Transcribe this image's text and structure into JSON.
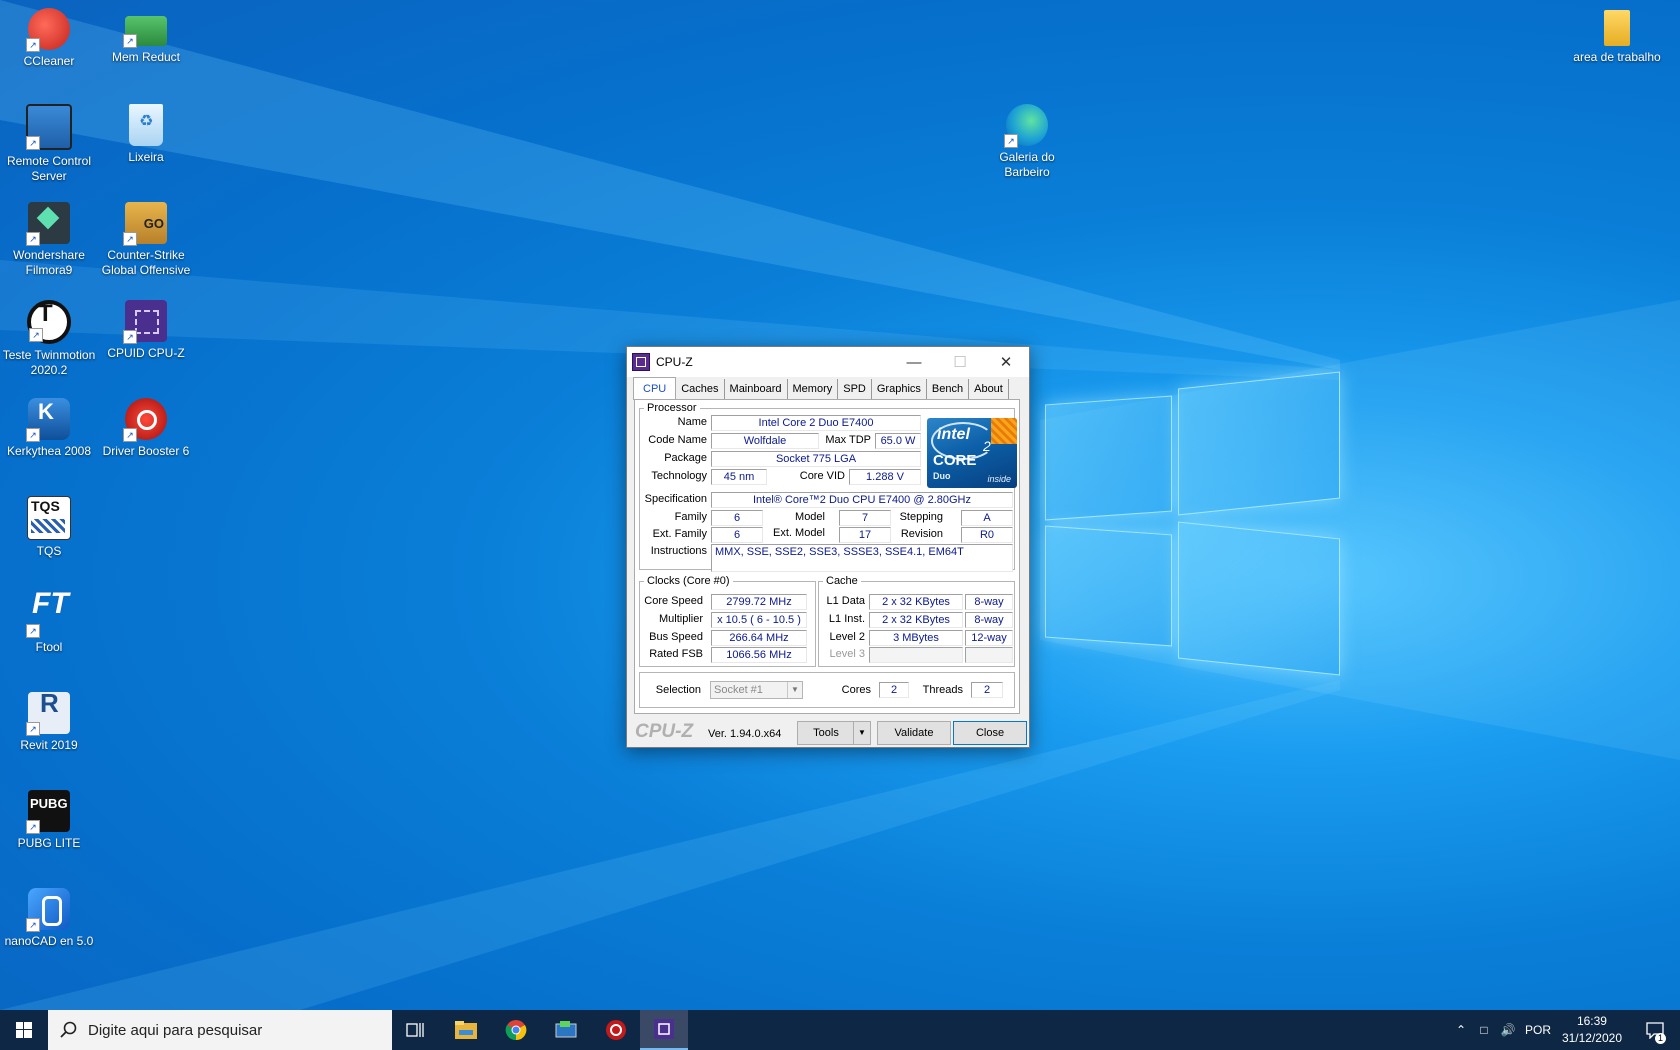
{
  "desktop": {
    "icons": [
      {
        "label_lines": [
          "CCleaner"
        ],
        "icon": "ccleaner-icon",
        "color": "#d9342b"
      },
      {
        "label_lines": [
          "Mem Reduct"
        ],
        "icon": "mem-reduct-icon",
        "color": "#3aa655"
      },
      {
        "label_lines": [
          "Remote Control",
          "Server"
        ],
        "icon": "remote-control-icon",
        "color": "#2a76c4"
      },
      {
        "label_lines": [
          "Lixeira"
        ],
        "icon": "recycle-bin-icon",
        "color": "#d6eefc"
      },
      {
        "label_lines": [
          "Wondershare",
          "Filmora9"
        ],
        "icon": "filmora-icon",
        "color": "#2b3a43"
      },
      {
        "label_lines": [
          "Counter-Strike",
          "Global Offensive"
        ],
        "icon": "csgo-icon",
        "color": "#d9a23c"
      },
      {
        "label_lines": [
          "Teste Twinmotion",
          "2020.2"
        ],
        "icon": "twinmotion-icon",
        "color": "#111111"
      },
      {
        "label_lines": [
          "CPUID CPU-Z"
        ],
        "icon": "cpuz-icon",
        "color": "#4b2f8f"
      },
      {
        "label_lines": [
          "Kerkythea 2008"
        ],
        "icon": "kerkythea-icon",
        "color": "#1d6fc7"
      },
      {
        "label_lines": [
          "Driver Booster 6"
        ],
        "icon": "driver-booster-icon",
        "color": "#c21a1a"
      },
      {
        "label_lines": [
          "TQS"
        ],
        "icon": "tqs-icon",
        "color": "#ffffff"
      },
      {
        "label_lines": [
          "Ftool"
        ],
        "icon": "ftool-icon",
        "color": "#2d79d1"
      },
      {
        "label_lines": [
          "Revit 2019"
        ],
        "icon": "revit-icon",
        "color": "#ffffff"
      },
      {
        "label_lines": [
          "PUBG LITE"
        ],
        "icon": "pubg-icon",
        "color": "#111111"
      },
      {
        "label_lines": [
          "nanoCAD en 5.0"
        ],
        "icon": "nanocad-icon",
        "color": "#1e6fd1"
      },
      {
        "label_lines": [
          "Galeria do",
          "Barbeiro"
        ],
        "icon": "edge-icon",
        "color": "#1aa7b0"
      },
      {
        "label_lines": [
          "area de trabalho"
        ],
        "icon": "folder-icon",
        "color": "#f2c744"
      }
    ]
  },
  "window": {
    "title": "CPU-Z",
    "tabs": [
      "CPU",
      "Caches",
      "Mainboard",
      "Memory",
      "SPD",
      "Graphics",
      "Bench",
      "About"
    ],
    "active_tab": "CPU",
    "processor": {
      "legend": "Processor",
      "name_label": "Name",
      "name": "Intel Core 2 Duo E7400",
      "codename_label": "Code Name",
      "codename": "Wolfdale",
      "maxtdp_label": "Max TDP",
      "maxtdp": "65.0 W",
      "package_label": "Package",
      "package": "Socket 775 LGA",
      "technology_label": "Technology",
      "technology": "45 nm",
      "corevid_label": "Core VID",
      "corevid": "1.288 V",
      "spec_label": "Specification",
      "spec": "Intel® Core™2 Duo CPU     E7400  @ 2.80GHz",
      "family_label": "Family",
      "family": "6",
      "model_label": "Model",
      "model": "7",
      "stepping_label": "Stepping",
      "stepping": "A",
      "extfamily_label": "Ext. Family",
      "extfamily": "6",
      "extmodel_label": "Ext. Model",
      "extmodel": "17",
      "revision_label": "Revision",
      "revision": "R0",
      "instructions_label": "Instructions",
      "instructions": "MMX, SSE, SSE2, SSE3, SSSE3, SSE4.1, EM64T",
      "logo": {
        "brand": "intel",
        "line": "CORE",
        "sub": "Duo",
        "inside": "inside",
        "num": "2"
      }
    },
    "clocks": {
      "legend": "Clocks (Core #0)",
      "core_speed_label": "Core Speed",
      "core_speed": "2799.72 MHz",
      "multiplier_label": "Multiplier",
      "multiplier": "x 10.5 ( 6 - 10.5 )",
      "bus_speed_label": "Bus Speed",
      "bus_speed": "266.64 MHz",
      "rated_fsb_label": "Rated FSB",
      "rated_fsb": "1066.56 MHz"
    },
    "cache": {
      "legend": "Cache",
      "l1data_label": "L1 Data",
      "l1data": "2 x 32 KBytes",
      "l1data_way": "8-way",
      "l1inst_label": "L1 Inst.",
      "l1inst": "2 x 32 KBytes",
      "l1inst_way": "8-way",
      "l2_label": "Level 2",
      "l2": "3 MBytes",
      "l2_way": "12-way",
      "l3_label": "Level 3"
    },
    "selection": {
      "label": "Selection",
      "value": "Socket #1",
      "cores_label": "Cores",
      "cores": "2",
      "threads_label": "Threads",
      "threads": "2"
    },
    "footer": {
      "brand": "CPU-Z",
      "version": "Ver. 1.94.0.x64",
      "tools": "Tools",
      "validate": "Validate",
      "close": "Close"
    }
  },
  "taskbar": {
    "search_placeholder": "Digite aqui para pesquisar",
    "language": "POR",
    "time": "16:39",
    "date": "31/12/2020",
    "notification_count": "1",
    "accent": "#76b9ed"
  }
}
